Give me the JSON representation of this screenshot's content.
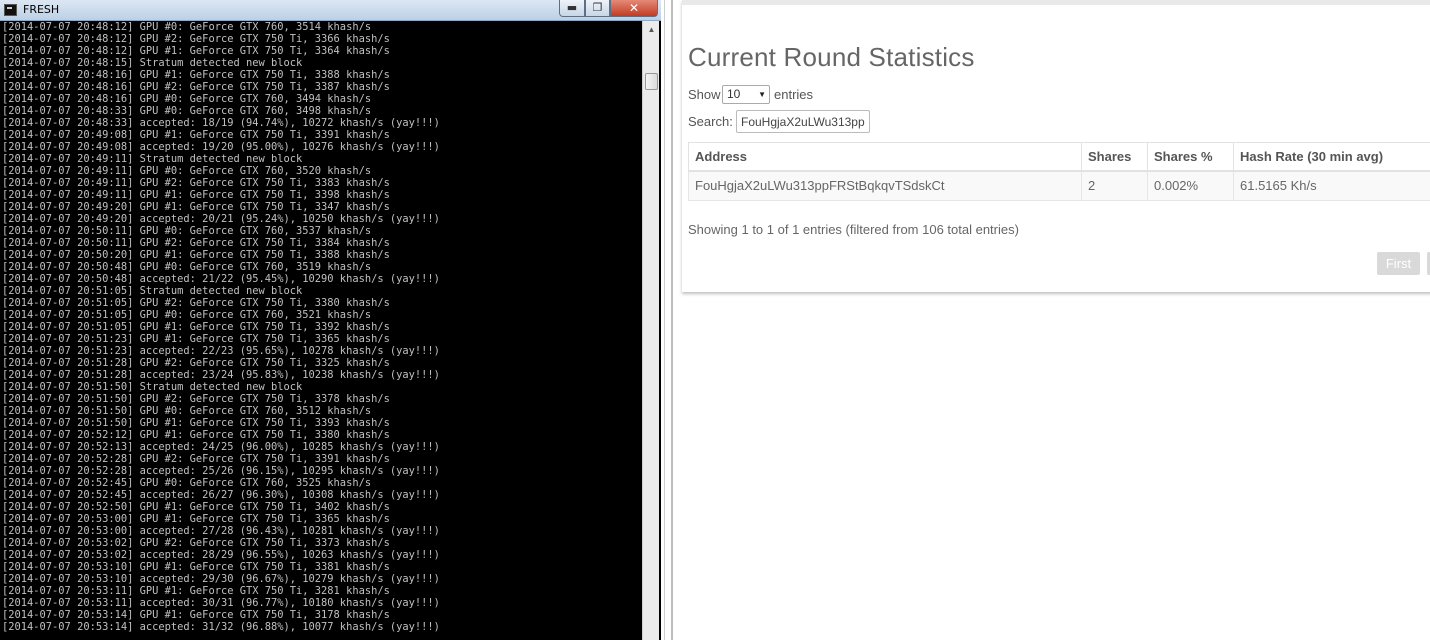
{
  "console": {
    "title": "FRESH",
    "controls": {
      "minimize": "▬",
      "maximize": "❐",
      "close": "✕"
    },
    "lines": [
      "[2014-07-07 20:48:12] GPU #0: GeForce GTX 760, 3514 khash/s",
      "[2014-07-07 20:48:12] GPU #2: GeForce GTX 750 Ti, 3366 khash/s",
      "[2014-07-07 20:48:12] GPU #1: GeForce GTX 750 Ti, 3364 khash/s",
      "[2014-07-07 20:48:15] Stratum detected new block",
      "[2014-07-07 20:48:16] GPU #1: GeForce GTX 750 Ti, 3388 khash/s",
      "[2014-07-07 20:48:16] GPU #2: GeForce GTX 750 Ti, 3387 khash/s",
      "[2014-07-07 20:48:16] GPU #0: GeForce GTX 760, 3494 khash/s",
      "[2014-07-07 20:48:33] GPU #0: GeForce GTX 760, 3498 khash/s",
      "[2014-07-07 20:48:33] accepted: 18/19 (94.74%), 10272 khash/s (yay!!!)",
      "[2014-07-07 20:49:08] GPU #1: GeForce GTX 750 Ti, 3391 khash/s",
      "[2014-07-07 20:49:08] accepted: 19/20 (95.00%), 10276 khash/s (yay!!!)",
      "[2014-07-07 20:49:11] Stratum detected new block",
      "[2014-07-07 20:49:11] GPU #0: GeForce GTX 760, 3520 khash/s",
      "[2014-07-07 20:49:11] GPU #2: GeForce GTX 750 Ti, 3383 khash/s",
      "[2014-07-07 20:49:11] GPU #1: GeForce GTX 750 Ti, 3398 khash/s",
      "[2014-07-07 20:49:20] GPU #1: GeForce GTX 750 Ti, 3347 khash/s",
      "[2014-07-07 20:49:20] accepted: 20/21 (95.24%), 10250 khash/s (yay!!!)",
      "[2014-07-07 20:50:11] GPU #0: GeForce GTX 760, 3537 khash/s",
      "[2014-07-07 20:50:11] GPU #2: GeForce GTX 750 Ti, 3384 khash/s",
      "[2014-07-07 20:50:20] GPU #1: GeForce GTX 750 Ti, 3388 khash/s",
      "[2014-07-07 20:50:48] GPU #0: GeForce GTX 760, 3519 khash/s",
      "[2014-07-07 20:50:48] accepted: 21/22 (95.45%), 10290 khash/s (yay!!!)",
      "[2014-07-07 20:51:05] Stratum detected new block",
      "[2014-07-07 20:51:05] GPU #2: GeForce GTX 750 Ti, 3380 khash/s",
      "[2014-07-07 20:51:05] GPU #0: GeForce GTX 760, 3521 khash/s",
      "[2014-07-07 20:51:05] GPU #1: GeForce GTX 750 Ti, 3392 khash/s",
      "[2014-07-07 20:51:23] GPU #1: GeForce GTX 750 Ti, 3365 khash/s",
      "[2014-07-07 20:51:23] accepted: 22/23 (95.65%), 10278 khash/s (yay!!!)",
      "[2014-07-07 20:51:28] GPU #2: GeForce GTX 750 Ti, 3325 khash/s",
      "[2014-07-07 20:51:28] accepted: 23/24 (95.83%), 10238 khash/s (yay!!!)",
      "[2014-07-07 20:51:50] Stratum detected new block",
      "[2014-07-07 20:51:50] GPU #2: GeForce GTX 750 Ti, 3378 khash/s",
      "[2014-07-07 20:51:50] GPU #0: GeForce GTX 760, 3512 khash/s",
      "[2014-07-07 20:51:50] GPU #1: GeForce GTX 750 Ti, 3393 khash/s",
      "[2014-07-07 20:52:12] GPU #1: GeForce GTX 750 Ti, 3380 khash/s",
      "[2014-07-07 20:52:13] accepted: 24/25 (96.00%), 10285 khash/s (yay!!!)",
      "[2014-07-07 20:52:28] GPU #2: GeForce GTX 750 Ti, 3391 khash/s",
      "[2014-07-07 20:52:28] accepted: 25/26 (96.15%), 10295 khash/s (yay!!!)",
      "[2014-07-07 20:52:45] GPU #0: GeForce GTX 760, 3525 khash/s",
      "[2014-07-07 20:52:45] accepted: 26/27 (96.30%), 10308 khash/s (yay!!!)",
      "[2014-07-07 20:52:50] GPU #1: GeForce GTX 750 Ti, 3402 khash/s",
      "[2014-07-07 20:53:00] GPU #1: GeForce GTX 750 Ti, 3365 khash/s",
      "[2014-07-07 20:53:00] accepted: 27/28 (96.43%), 10281 khash/s (yay!!!)",
      "[2014-07-07 20:53:02] GPU #2: GeForce GTX 750 Ti, 3373 khash/s",
      "[2014-07-07 20:53:02] accepted: 28/29 (96.55%), 10263 khash/s (yay!!!)",
      "[2014-07-07 20:53:10] GPU #1: GeForce GTX 750 Ti, 3381 khash/s",
      "[2014-07-07 20:53:10] accepted: 29/30 (96.67%), 10279 khash/s (yay!!!)",
      "[2014-07-07 20:53:11] GPU #1: GeForce GTX 750 Ti, 3281 khash/s",
      "[2014-07-07 20:53:11] accepted: 30/31 (96.77%), 10180 khash/s (yay!!!)",
      "[2014-07-07 20:53:14] GPU #1: GeForce GTX 750 Ti, 3178 khash/s",
      "[2014-07-07 20:53:14] accepted: 31/32 (96.88%), 10077 khash/s (yay!!!)"
    ]
  },
  "stats": {
    "title": "Current Round Statistics",
    "show_label": "Show",
    "entries_value": "10",
    "entries_label": "entries",
    "search_label": "Search:",
    "search_value": "FouHgjaX2uLWu313pp",
    "table": {
      "headers": [
        "Address",
        "Shares",
        "Shares %",
        "Hash Rate (30 min avg)"
      ],
      "rows": [
        [
          "FouHgjaX2uLWu313ppFRStBqkqvTSdskCt",
          "2",
          "0.002%",
          "61.5165 Kh/s"
        ]
      ]
    },
    "info": "Showing 1 to 1 of 1 entries (filtered from 106 total entries)",
    "pagination": {
      "first": "First"
    }
  }
}
